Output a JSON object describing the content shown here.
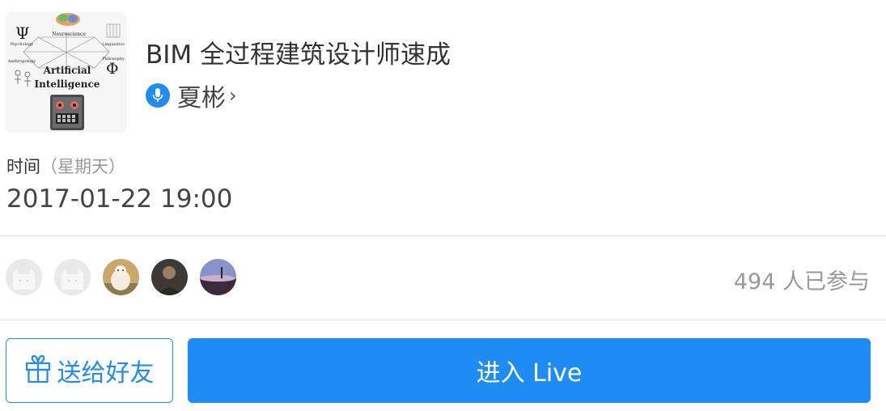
{
  "cover": {
    "icon": "ai-disciplines-cover-icon",
    "labels": {
      "neuroscience": "Neuroscience",
      "linguistics": "Linguistics",
      "psychology": "Psychology",
      "philosophy": "Philosophy",
      "anthropology": "Anthropology",
      "ai_line1": "Artificial",
      "ai_line2": "Intelligence"
    }
  },
  "header": {
    "title": "BIM 全过程建筑设计师速成"
  },
  "speaker": {
    "icon": "microphone-icon",
    "name": "夏彬",
    "chevron": "›"
  },
  "schedule": {
    "label": "时间",
    "weekday": "（星期天）",
    "datetime": "2017-01-22 19:00"
  },
  "participants": {
    "avatars": [
      "default-avatar",
      "default-avatar",
      "polar-bear-avatar",
      "person-avatar",
      "landscape-avatar"
    ],
    "count_text": "494 人已参与"
  },
  "actions": {
    "gift_icon": "gift-icon",
    "gift_label": "送给好友",
    "enter_label": "进入 Live"
  },
  "colors": {
    "accent": "#1f8cf5",
    "muted_text": "#999999",
    "divider": "#e8e8e8"
  }
}
